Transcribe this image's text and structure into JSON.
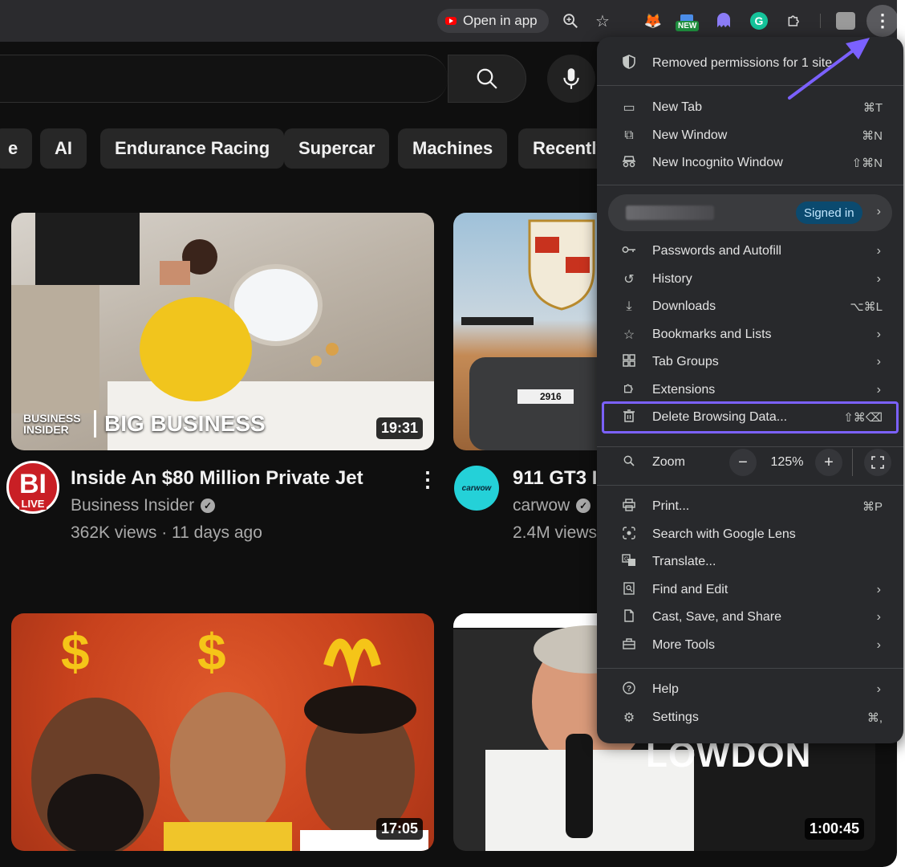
{
  "toolbar": {
    "open_in_app": "Open in app",
    "new_badge": "NEW",
    "icons": [
      "zoom-icon",
      "bookmark-star-icon",
      "metamask-fox-icon",
      "extension-new-icon",
      "ghost-extension-icon",
      "grammarly-icon",
      "extensions-puzzle-icon",
      "profile-icon",
      "menu-kebab-icon"
    ]
  },
  "chips": [
    "e",
    "AI",
    "Endurance Racing",
    "Supercar",
    "Machines",
    "Recently"
  ],
  "videos": [
    {
      "title": "Inside An $80 Million Private Jet",
      "channel": "Business Insider",
      "meta": "362K views · 11 days ago",
      "duration": "19:31",
      "thumb_brand": "BUSINESS INSIDER",
      "thumb_text": "BIG BUSINESS",
      "avatar_text": "BI",
      "avatar_badge": "LIVE"
    },
    {
      "title": "911 GT3 I",
      "channel": "carwow",
      "meta": "2.4M views",
      "avatar_text": "carwow",
      "plate": "2916"
    },
    {
      "duration": "17:05"
    },
    {
      "duration": "1:00:45",
      "thumb_text": "LOWDON"
    }
  ],
  "menu": {
    "notice": "Removed permissions for 1 site",
    "items_top": [
      {
        "label": "New Tab",
        "shortcut": "⌘T",
        "icon": "new-tab-icon"
      },
      {
        "label": "New Window",
        "shortcut": "⌘N",
        "icon": "new-window-icon"
      },
      {
        "label": "New Incognito Window",
        "shortcut": "⇧⌘N",
        "icon": "incognito-icon"
      }
    ],
    "signed_in": "Signed in",
    "items_mid": [
      {
        "label": "Passwords and Autofill",
        "icon": "key-icon"
      },
      {
        "label": "History",
        "icon": "history-icon"
      },
      {
        "label": "Downloads",
        "shortcut": "⌥⌘L",
        "icon": "download-icon"
      },
      {
        "label": "Bookmarks and Lists",
        "icon": "star-icon"
      },
      {
        "label": "Tab Groups",
        "icon": "tab-groups-icon"
      },
      {
        "label": "Extensions",
        "icon": "puzzle-icon"
      },
      {
        "label": "Delete Browsing Data...",
        "shortcut": "⇧⌘⌫",
        "icon": "trash-icon"
      }
    ],
    "zoom": {
      "label": "Zoom",
      "value": "125%",
      "minus": "−",
      "plus": "+"
    },
    "items_tools": [
      {
        "label": "Print...",
        "shortcut": "⌘P",
        "icon": "print-icon"
      },
      {
        "label": "Search with Google Lens",
        "icon": "lens-icon"
      },
      {
        "label": "Translate...",
        "icon": "translate-icon"
      },
      {
        "label": "Find and Edit",
        "icon": "find-icon"
      },
      {
        "label": "Cast, Save, and Share",
        "icon": "cast-icon"
      },
      {
        "label": "More Tools",
        "icon": "toolbox-icon"
      }
    ],
    "items_bottom": [
      {
        "label": "Help",
        "icon": "help-icon"
      },
      {
        "label": "Settings",
        "shortcut": "⌘,",
        "icon": "gear-icon"
      }
    ]
  },
  "colors": {
    "highlight": "#7b61ff",
    "menu_bg": "#28292c",
    "page_bg": "#0f0f0f"
  }
}
